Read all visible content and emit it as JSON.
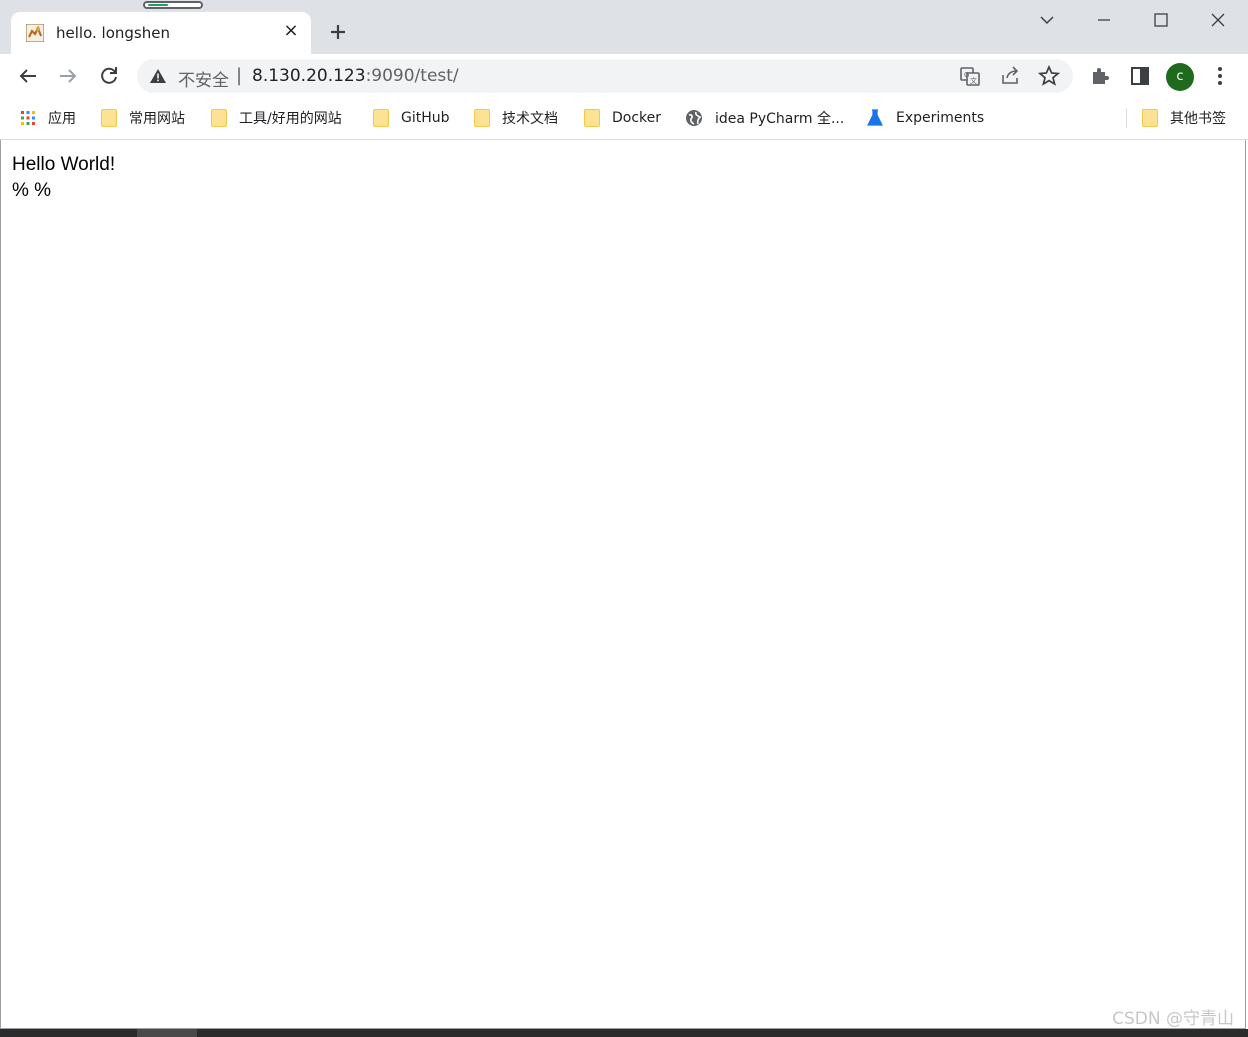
{
  "tab": {
    "title": "hello. longshen",
    "close_glyph": "×"
  },
  "window_controls": [
    "chevron-down-icon",
    "minimize-icon",
    "maximize-icon",
    "close-icon"
  ],
  "omnibox": {
    "security_label": "不安全",
    "separator": "|",
    "url_host": "8.130.20.123",
    "url_rest": ":9090/test/"
  },
  "profile": {
    "initial": "c",
    "color": "#1e6b1e"
  },
  "bookmarks": {
    "items": [
      {
        "label": "应用",
        "icon": "apps-grid-icon"
      },
      {
        "label": "常用网站",
        "icon": "folder-icon"
      },
      {
        "label": "工具/好用的网站",
        "icon": "folder-icon"
      },
      {
        "label": "GitHub",
        "icon": "folder-icon"
      },
      {
        "label": "技术文档",
        "icon": "folder-icon"
      },
      {
        "label": "Docker",
        "icon": "folder-icon"
      },
      {
        "label": "idea PyCharm 全...",
        "icon": "globe-icon"
      },
      {
        "label": "Experiments",
        "icon": "flask-icon"
      }
    ],
    "other": {
      "label": "其他书签",
      "icon": "folder-icon"
    }
  },
  "page": {
    "line1": "Hello World!",
    "line2": "% %"
  },
  "watermark": "CSDN @守青山"
}
